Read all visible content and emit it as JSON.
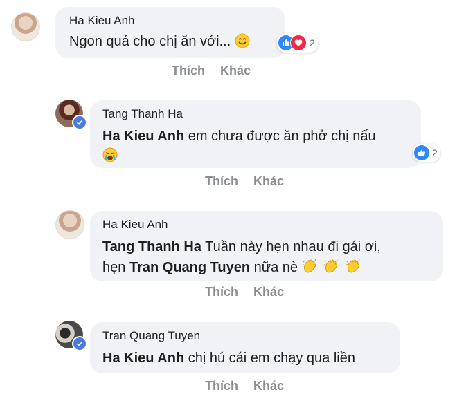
{
  "comments": [
    {
      "author": "Ha Kieu Anh",
      "text": "Ngon quá cho chị ăn với...",
      "reaction_count": "2",
      "like_label": "Thích",
      "reply_label": "Khác"
    },
    {
      "author": "Tang Thanh Ha",
      "mention": "Ha Kieu Anh",
      "text": "em chưa được ăn phở chị nấu",
      "reaction_count": "2",
      "like_label": "Thích",
      "reply_label": "Khác"
    },
    {
      "author": "Ha Kieu Anh",
      "mention": "Tang Thanh Ha",
      "text": "Tuần này hẹn nhau đi gái ơi,",
      "line2_prefix": "hẹn",
      "mention2": "Tran Quang Tuyen",
      "line2_suffix": "nữa nè",
      "like_label": "Thích",
      "reply_label": "Khác"
    },
    {
      "author": "Tran Quang Tuyen",
      "mention": "Ha Kieu Anh",
      "text": "chị hú cái em chạy qua liền",
      "like_label": "Thích",
      "reply_label": "Khác"
    }
  ],
  "colors": {
    "bubble": "#f0f2f5",
    "like": "#2d88ff",
    "heart": "#f0284a",
    "verified": "#4a7ddb",
    "action_text": "#8a8d91"
  },
  "icons": [
    "smiling-emoji-icon",
    "crying-emoji-icon",
    "clapping-hands-icon",
    "like-icon",
    "heart-icon",
    "verified-badge-icon"
  ]
}
